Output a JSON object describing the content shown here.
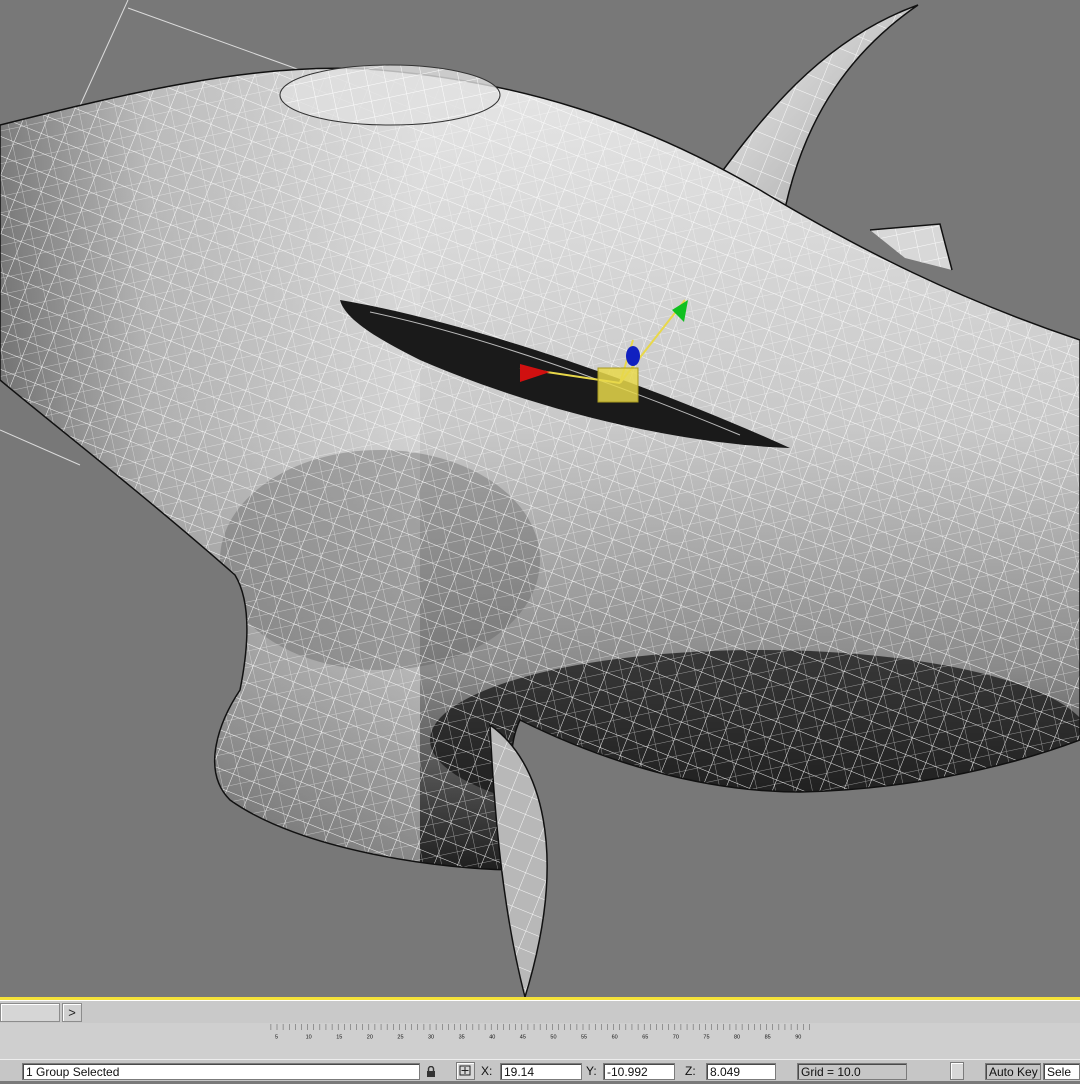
{
  "viewport": {
    "name": "perspective-viewport",
    "background": "#787878",
    "mesh_line_color": "#ffffff",
    "gizmo_colors": {
      "x": "#d01010",
      "y": "#10c020",
      "z": "#1020c0",
      "center": "#e8d84a"
    }
  },
  "timeline": {
    "next_frame_label": ">",
    "ticks": [
      "5",
      "10",
      "15",
      "20",
      "25",
      "30",
      "35",
      "40",
      "45",
      "50",
      "55",
      "60",
      "65",
      "70",
      "75",
      "80",
      "85",
      "90"
    ]
  },
  "status": {
    "selection_info": "1 Group Selected",
    "x_label": "X:",
    "x_value": "19.14",
    "y_label": "Y:",
    "y_value": "-10.992",
    "z_label": "Z:",
    "z_value": "8.049",
    "grid_text": "Grid = 10.0",
    "auto_key_label": "Auto Key",
    "selected_dropdown_text": "Sele"
  },
  "colors": {
    "selection_border": "#f4e23a",
    "panel": "#c8c8c8"
  }
}
